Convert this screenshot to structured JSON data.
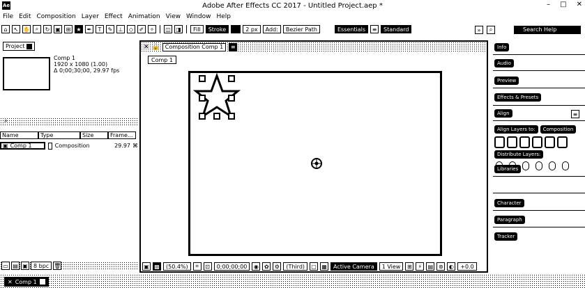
{
  "window": {
    "app_icon": "Ae",
    "title": "Adobe After Effects CC 2017 - Untitled Project.aep *",
    "controls": [
      "–",
      "□",
      "✕"
    ]
  },
  "menu": [
    "File",
    "Edit",
    "Composition",
    "Layer",
    "Effect",
    "Animation",
    "View",
    "Window",
    "Help"
  ],
  "toolbar": {
    "fill_label": "Fill",
    "stroke_label": "Stroke",
    "stroke_width": "2 px",
    "add_label": "Add:",
    "bezier_label": "Bezier Path",
    "workspace_essentials": "Essentials",
    "workspace_standard": "Standard",
    "search_placeholder": "Search Help"
  },
  "project": {
    "tab_label": "Project",
    "comp_name": "Comp 1",
    "comp_size": "1920 x 1080 (1.00)",
    "comp_duration": "Δ 0;00;30;00, 29.97 fps",
    "columns": [
      "Name",
      "Type",
      "Size",
      "Frame..."
    ],
    "rows": [
      {
        "name": "Comp 1",
        "type": "Composition",
        "fps": "29.97"
      }
    ],
    "bpc": "8 bpc"
  },
  "composition": {
    "tab_label": "Composition Comp 1",
    "breadcrumb": "Comp 1",
    "zoom": "(50.4%)",
    "timecode": "0;00;00;00",
    "resolution": "(Third)",
    "camera": "Active Camera",
    "view": "1 View",
    "exposure": "+0.0"
  },
  "right_panel": {
    "items": [
      "Info",
      "Audio",
      "Preview",
      "Effects & Presets",
      "Align",
      "Libraries",
      "Character",
      "Paragraph",
      "Tracker"
    ],
    "align_layers_to_label": "Align Layers to:",
    "align_target": "Composition",
    "distribute_label": "Distribute Layers:"
  },
  "timeline": {
    "tab_label": "Comp 1"
  },
  "colors": {
    "foreground": "#000000",
    "background": "#ffffff"
  }
}
